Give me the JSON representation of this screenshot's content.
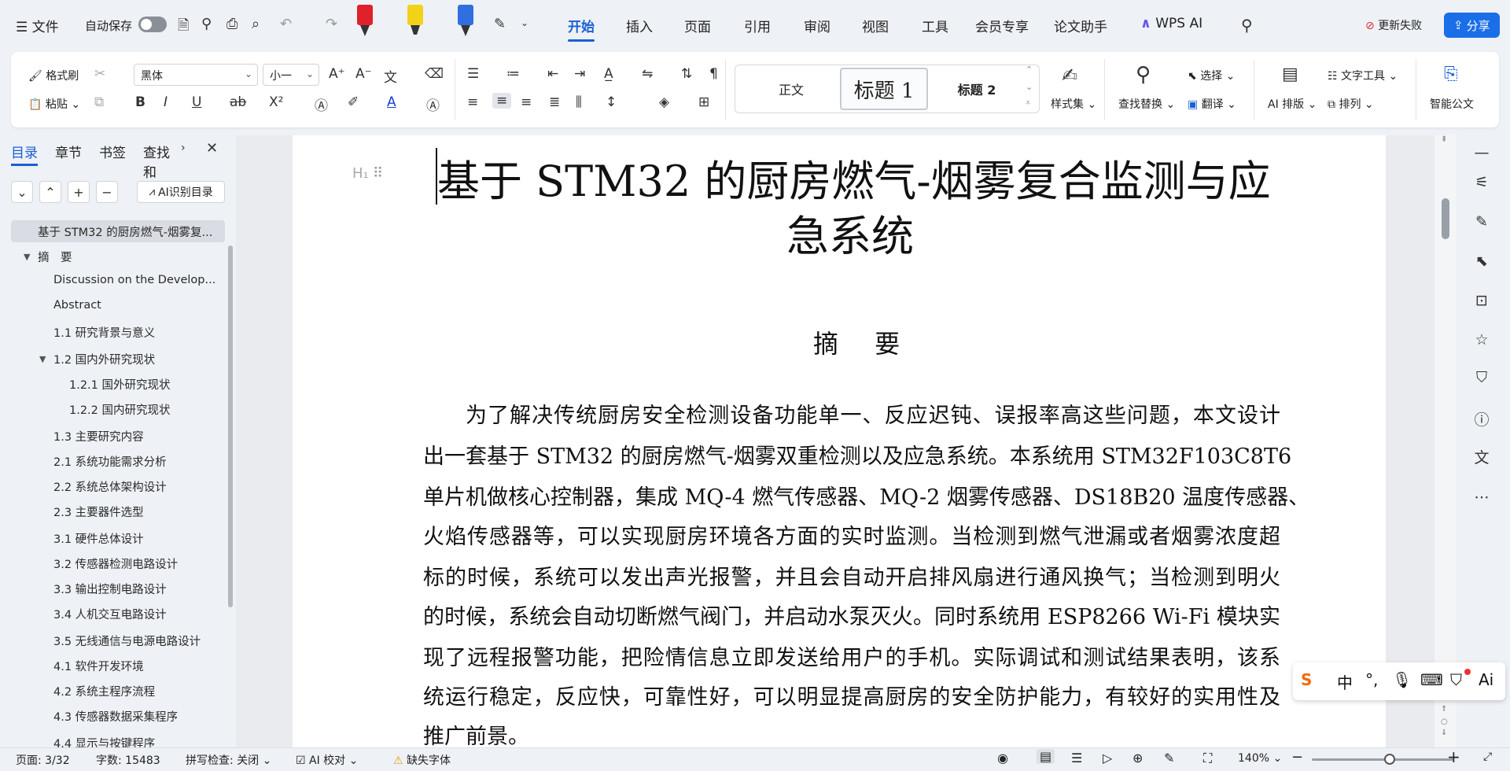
{
  "menubar": {
    "file_label": "文件",
    "autosave_label": "自动保存",
    "tabs": [
      "开始",
      "插入",
      "页面",
      "引用",
      "审阅",
      "视图",
      "工具",
      "会员专享",
      "论文助手"
    ],
    "wps_ai_label": "WPS AI",
    "update_fail_label": "更新失败",
    "share_label": "分享"
  },
  "ribbon": {
    "format_painter": "格式刷",
    "paste": "粘贴",
    "font_name": "黑体",
    "font_size": "小一",
    "styles": [
      "正文",
      "标题 1",
      "标题 2"
    ],
    "style_set": "样式集",
    "find_replace": "查找替换",
    "select": "选择",
    "translate": "翻译",
    "ai_layout": "AI 排版",
    "text_tools": "文字工具",
    "arrange": "排列",
    "smart_doc": "智能公文"
  },
  "nav": {
    "tabs": [
      "目录",
      "章节",
      "书签",
      "查找和"
    ],
    "ai_toc_label": "AI识别目录",
    "items": [
      "基于 STM32 的厨房燃气-烟雾复...",
      "摘　要",
      "Discussion on the Develop...",
      "Abstract",
      "1.1  研究背景与意义",
      "1.2  国内外研究现状",
      "1.2.1  国外研究现状",
      "1.2.2  国内研究现状",
      "1.3  主要研究内容",
      "2.1  系统功能需求分析",
      "2.2  系统总体架构设计",
      "2.3  主要器件选型",
      "3.1  硬件总体设计",
      "3.2  传感器检测电路设计",
      "3.3  输出控制电路设计",
      "3.4  人机交互电路设计",
      "3.5  无线通信与电源电路设计",
      "4.1  软件开发环境",
      "4.2  系统主程序流程",
      "4.3  传感器数据采集程序",
      "4.4  显示与按键程序"
    ]
  },
  "document": {
    "title_line1": "基于 STM32 的厨房燃气-烟雾复合监测与应",
    "title_line2": "急系统",
    "heading_abstract": "摘 要",
    "heading_marker": "H₁",
    "paragraph_lines": [
      "为了解决传统厨房安全检测设备功能单一、反应迟钝、误报率高这些问题，本文设计",
      "出一套基于 STM32 的厨房燃气-烟雾双重检测以及应急系统。本系统用 STM32F103C8T6",
      "单片机做核心控制器，集成 MQ-4 燃气传感器、MQ-2 烟雾传感器、DS18B20 温度传感器、",
      "火焰传感器等，可以实现厨房环境各方面的实时监测。当检测到燃气泄漏或者烟雾浓度超",
      "标的时候，系统可以发出声光报警，并且会自动开启排风扇进行通风换气；当检测到明火",
      "的时候，系统会自动切断燃气阀门，并启动水泵灭火。同时系统用 ESP8266 Wi-Fi 模块实",
      "现了远程报警功能，把险情信息立即发送给用户的手机。实际调试和测试结果表明，该系",
      "统运行稳定，反应快，可靠性好，可以明显提高厨房的安全防护能力，有较好的实用性及",
      "推广前景。"
    ]
  },
  "ime": {
    "lang": "中",
    "ai": "Ai"
  },
  "status": {
    "page": "页面: 3/32",
    "words": "字数: 15483",
    "spell": "拼写检查: 关闭",
    "ai_proof": "AI 校对",
    "missing_font": "缺失字体",
    "zoom": "140%"
  },
  "colors": {
    "accent": "#1a5fd4",
    "share_button": "#1a6ee8",
    "pen_red": "#e0202a",
    "pen_yellow": "#f3d21a",
    "pen_blue": "#2f6fe0"
  }
}
